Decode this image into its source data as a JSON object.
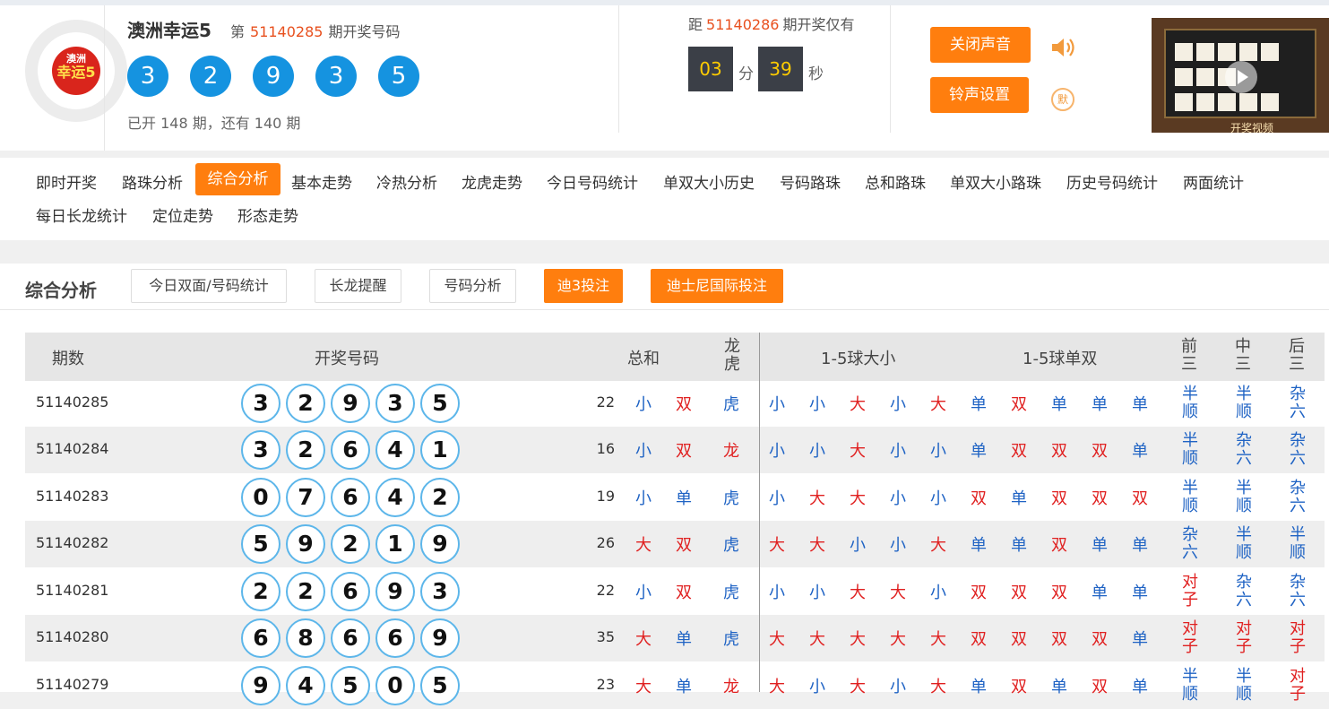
{
  "header": {
    "logo_text_top": "澳洲",
    "logo_text_bottom": "幸运5",
    "lottery_name": "澳洲幸运5",
    "issue_prefix": "第",
    "issue_number": "51140285",
    "issue_suffix": "期开奖号码",
    "balls": [
      "3",
      "2",
      "9",
      "3",
      "5"
    ],
    "progress_text": "已开 148 期，还有 140 期",
    "countdown_prefix": "距",
    "next_issue": "51140286",
    "countdown_suffix": "期开奖仅有",
    "minutes": "03",
    "minutes_unit": "分",
    "seconds": "39",
    "seconds_unit": "秒",
    "sound_off_label": "关闭声音",
    "ringtone_label": "铃声设置",
    "mute_badge": "默",
    "video_caption": "开奖视频"
  },
  "nav": {
    "items": [
      "即时开奖",
      "路珠分析",
      "综合分析",
      "基本走势",
      "冷热分析",
      "龙虎走势",
      "今日号码统计",
      "单双大小历史",
      "号码路珠",
      "总和路珠",
      "单双大小路珠",
      "历史号码统计",
      "两面统计",
      "每日长龙统计",
      "定位走势",
      "形态走势"
    ],
    "active": "综合分析"
  },
  "panel": {
    "title": "综合分析",
    "buttons": [
      "今日双面/号码统计",
      "长龙提醒",
      "号码分析"
    ],
    "orange_buttons": [
      "迪3投注",
      "迪士尼国际投注"
    ]
  },
  "table": {
    "headers": {
      "issue": "期数",
      "numbers": "开奖号码",
      "sum": "总和",
      "dragon_tiger": "龙虎",
      "big_small": "1-5球大小",
      "odd_even": "1-5球单双",
      "front": "前三",
      "middle": "中三",
      "back": "后三"
    },
    "rows": [
      {
        "issue": "51140285",
        "nums": [
          "3",
          "2",
          "9",
          "3",
          "5"
        ],
        "sum": "22",
        "sum_bs": "小",
        "sum_oe": "双",
        "dt": "虎",
        "bs": [
          "小",
          "小",
          "大",
          "小",
          "大"
        ],
        "oe": [
          "单",
          "双",
          "单",
          "单",
          "单"
        ],
        "front": "半顺",
        "middle": "半顺",
        "back": "杂六"
      },
      {
        "issue": "51140284",
        "nums": [
          "3",
          "2",
          "6",
          "4",
          "1"
        ],
        "sum": "16",
        "sum_bs": "小",
        "sum_oe": "双",
        "dt": "龙",
        "bs": [
          "小",
          "小",
          "大",
          "小",
          "小"
        ],
        "oe": [
          "单",
          "双",
          "双",
          "双",
          "单"
        ],
        "front": "半顺",
        "middle": "杂六",
        "back": "杂六"
      },
      {
        "issue": "51140283",
        "nums": [
          "0",
          "7",
          "6",
          "4",
          "2"
        ],
        "sum": "19",
        "sum_bs": "小",
        "sum_oe": "单",
        "dt": "虎",
        "bs": [
          "小",
          "大",
          "大",
          "小",
          "小"
        ],
        "oe": [
          "双",
          "单",
          "双",
          "双",
          "双"
        ],
        "front": "半顺",
        "middle": "半顺",
        "back": "杂六"
      },
      {
        "issue": "51140282",
        "nums": [
          "5",
          "9",
          "2",
          "1",
          "9"
        ],
        "sum": "26",
        "sum_bs": "大",
        "sum_oe": "双",
        "dt": "虎",
        "bs": [
          "大",
          "大",
          "小",
          "小",
          "大"
        ],
        "oe": [
          "单",
          "单",
          "双",
          "单",
          "单"
        ],
        "front": "杂六",
        "middle": "半顺",
        "back": "半顺"
      },
      {
        "issue": "51140281",
        "nums": [
          "2",
          "2",
          "6",
          "9",
          "3"
        ],
        "sum": "22",
        "sum_bs": "小",
        "sum_oe": "双",
        "dt": "虎",
        "bs": [
          "小",
          "小",
          "大",
          "大",
          "小"
        ],
        "oe": [
          "双",
          "双",
          "双",
          "单",
          "单"
        ],
        "front": "对子",
        "middle": "杂六",
        "back": "杂六"
      },
      {
        "issue": "51140280",
        "nums": [
          "6",
          "8",
          "6",
          "6",
          "9"
        ],
        "sum": "35",
        "sum_bs": "大",
        "sum_oe": "单",
        "dt": "虎",
        "bs": [
          "大",
          "大",
          "大",
          "大",
          "大"
        ],
        "oe": [
          "双",
          "双",
          "双",
          "双",
          "单"
        ],
        "front": "对子",
        "middle": "对子",
        "back": "对子"
      },
      {
        "issue": "51140279",
        "nums": [
          "9",
          "4",
          "5",
          "0",
          "5"
        ],
        "sum": "23",
        "sum_bs": "大",
        "sum_oe": "单",
        "dt": "龙",
        "bs": [
          "大",
          "小",
          "大",
          "小",
          "大"
        ],
        "oe": [
          "单",
          "双",
          "单",
          "双",
          "单"
        ],
        "front": "半顺",
        "middle": "半顺",
        "back": "对子"
      }
    ]
  },
  "colors": {
    "accent": "#ff7e0e",
    "ball_blue": "#1593e0",
    "red": "#e02020",
    "blue": "#1f63c4"
  }
}
